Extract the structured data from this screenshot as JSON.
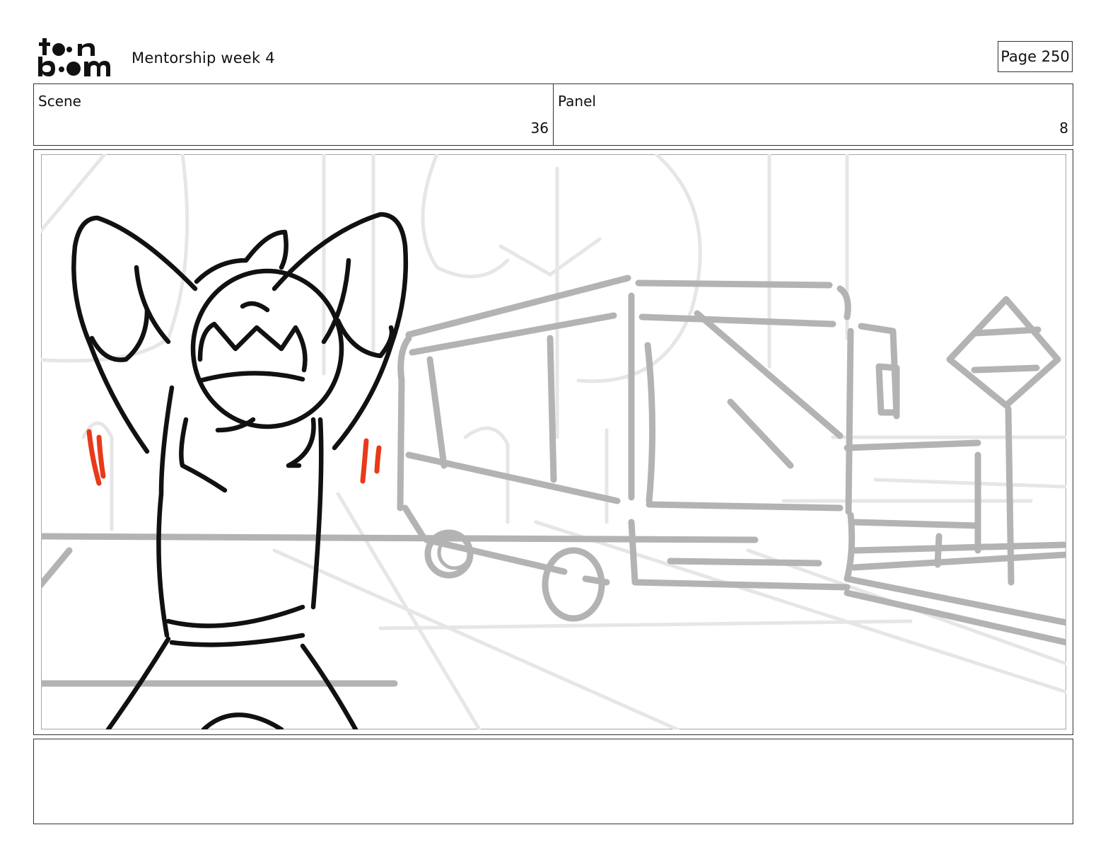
{
  "header": {
    "logo_text": "toon boom",
    "document_title": "Mentorship week 4",
    "page_label": "Page 250"
  },
  "info": {
    "scene_label": "Scene",
    "scene_value": "36",
    "panel_label": "Panel",
    "panel_value": "8"
  },
  "caption": {
    "text": ""
  },
  "colors": {
    "line": "#111111",
    "background_sketch": "#b3b3b3",
    "motion_marks": "#e83a1a",
    "border": "#333333"
  }
}
